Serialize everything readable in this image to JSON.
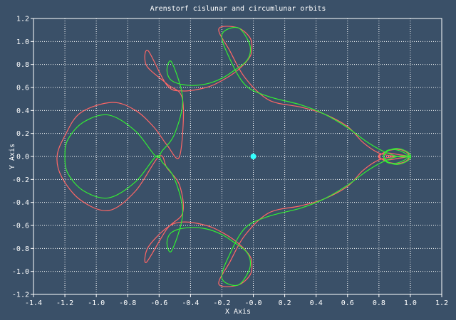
{
  "chart_data": {
    "type": "line",
    "title": "Arenstorf cislunar and circumlunar orbits",
    "xlabel": "X Axis",
    "ylabel": "Y Axis",
    "xlim": [
      -1.4,
      1.2
    ],
    "ylim": [
      -1.2,
      1.2
    ],
    "x_ticks": [
      "-1.4",
      "-1.2",
      "-1.0",
      "-0.8",
      "-0.6",
      "-0.4",
      "-0.2",
      "-0.0",
      "0.2",
      "0.4",
      "0.6",
      "0.8",
      "1.0",
      "1.2"
    ],
    "y_ticks": [
      "1.2",
      "1.0",
      "0.8",
      "0.6",
      "0.4",
      "0.2",
      "0.0",
      "-0.2",
      "-0.4",
      "-0.6",
      "-0.8",
      "-1.0",
      "-1.2"
    ],
    "grid": true,
    "series": [
      {
        "color": "#ff6666",
        "x": [
          1.0,
          0.93,
          0.86,
          0.81,
          0.8,
          0.84,
          0.9,
          0.96,
          0.99,
          0.92,
          0.8,
          0.7,
          0.6,
          0.45,
          0.3,
          0.1,
          -0.05,
          -0.15,
          -0.22,
          -0.1,
          -0.02,
          -0.01,
          -0.03,
          -0.1,
          -0.2,
          -0.3,
          -0.45,
          -0.55,
          -0.67,
          -0.68,
          -0.55,
          -0.45,
          -0.47,
          -0.55,
          -0.6,
          -0.75,
          -0.92,
          -1.1,
          -1.22,
          -1.25,
          -1.2,
          -1.1,
          -0.9,
          -0.75,
          -0.63,
          -0.55,
          -0.47,
          -0.45,
          -0.55,
          -0.68,
          -0.67,
          -0.55,
          -0.45,
          -0.3,
          -0.2,
          -0.1,
          -0.03,
          -0.01,
          -0.02,
          -0.1,
          -0.22,
          -0.15,
          -0.05,
          0.1,
          0.3,
          0.45,
          0.6,
          0.7,
          0.8,
          0.92,
          0.99,
          0.96,
          0.9,
          0.84,
          0.8,
          0.81,
          0.86,
          0.93,
          1.0
        ],
        "y": [
          0.0,
          0.015,
          0.03,
          0.02,
          0.0,
          -0.04,
          -0.06,
          -0.05,
          -0.01,
          0.0,
          -0.03,
          -0.12,
          -0.26,
          -0.37,
          -0.43,
          -0.49,
          -0.68,
          -0.92,
          -1.11,
          -1.12,
          -1.03,
          -0.92,
          -0.85,
          -0.75,
          -0.66,
          -0.6,
          -0.57,
          -0.62,
          -0.79,
          -0.92,
          -0.63,
          -0.49,
          -0.25,
          -0.1,
          0.0,
          -0.3,
          -0.47,
          -0.38,
          -0.18,
          0.0,
          0.18,
          0.38,
          0.47,
          0.4,
          0.25,
          0.1,
          0.0,
          0.49,
          0.63,
          0.79,
          0.92,
          0.62,
          0.57,
          0.6,
          0.66,
          0.75,
          0.85,
          0.92,
          1.03,
          1.12,
          1.11,
          0.92,
          0.68,
          0.49,
          0.43,
          0.37,
          0.26,
          0.12,
          0.03,
          0.0,
          0.01,
          0.05,
          0.06,
          0.04,
          0.0,
          -0.02,
          -0.03,
          -0.015,
          0.0
        ]
      },
      {
        "color": "#33ee33",
        "x": [
          1.0,
          0.95,
          0.9,
          0.85,
          0.83,
          0.86,
          0.92,
          0.98,
          1.0,
          0.92,
          0.82,
          0.72,
          0.6,
          0.45,
          0.3,
          0.1,
          -0.05,
          -0.15,
          -0.2,
          -0.1,
          -0.03,
          -0.02,
          -0.05,
          -0.12,
          -0.2,
          -0.3,
          -0.42,
          -0.52,
          -0.55,
          -0.52,
          -0.45,
          -0.5,
          -0.58,
          -0.62,
          -0.75,
          -0.92,
          -1.08,
          -1.18,
          -1.2,
          -1.18,
          -1.08,
          -0.92,
          -0.75,
          -0.62,
          -0.58,
          -0.5,
          -0.45,
          -0.52,
          -0.55,
          -0.52,
          -0.42,
          -0.3,
          -0.2,
          -0.12,
          -0.05,
          -0.02,
          -0.03,
          -0.1,
          -0.2,
          -0.15,
          -0.05,
          0.1,
          0.3,
          0.45,
          0.6,
          0.72,
          0.82,
          0.92,
          1.0,
          0.98,
          0.92,
          0.86,
          0.83,
          0.85,
          0.9,
          0.95,
          1.0
        ],
        "y": [
          0.0,
          0.04,
          0.06,
          0.05,
          0.0,
          -0.05,
          -0.07,
          -0.04,
          0.0,
          0.0,
          -0.05,
          -0.13,
          -0.25,
          -0.37,
          -0.45,
          -0.52,
          -0.62,
          -0.85,
          -1.06,
          -1.12,
          -1.0,
          -0.9,
          -0.82,
          -0.75,
          -0.68,
          -0.63,
          -0.62,
          -0.66,
          -0.75,
          -0.82,
          -0.5,
          -0.2,
          -0.05,
          0.0,
          -0.22,
          -0.36,
          -0.3,
          -0.15,
          0.0,
          0.15,
          0.3,
          0.36,
          0.22,
          0.0,
          0.05,
          0.2,
          0.5,
          0.82,
          0.75,
          0.66,
          0.62,
          0.63,
          0.68,
          0.75,
          0.82,
          0.9,
          1.0,
          1.12,
          1.06,
          0.85,
          0.62,
          0.52,
          0.45,
          0.37,
          0.25,
          0.13,
          0.05,
          0.0,
          0.0,
          0.04,
          0.07,
          0.05,
          0.0,
          -0.05,
          -0.06,
          -0.04,
          0.0
        ]
      }
    ],
    "markers": [
      {
        "x": -0.0,
        "y": 0.0,
        "color": "#33ffff"
      }
    ]
  }
}
